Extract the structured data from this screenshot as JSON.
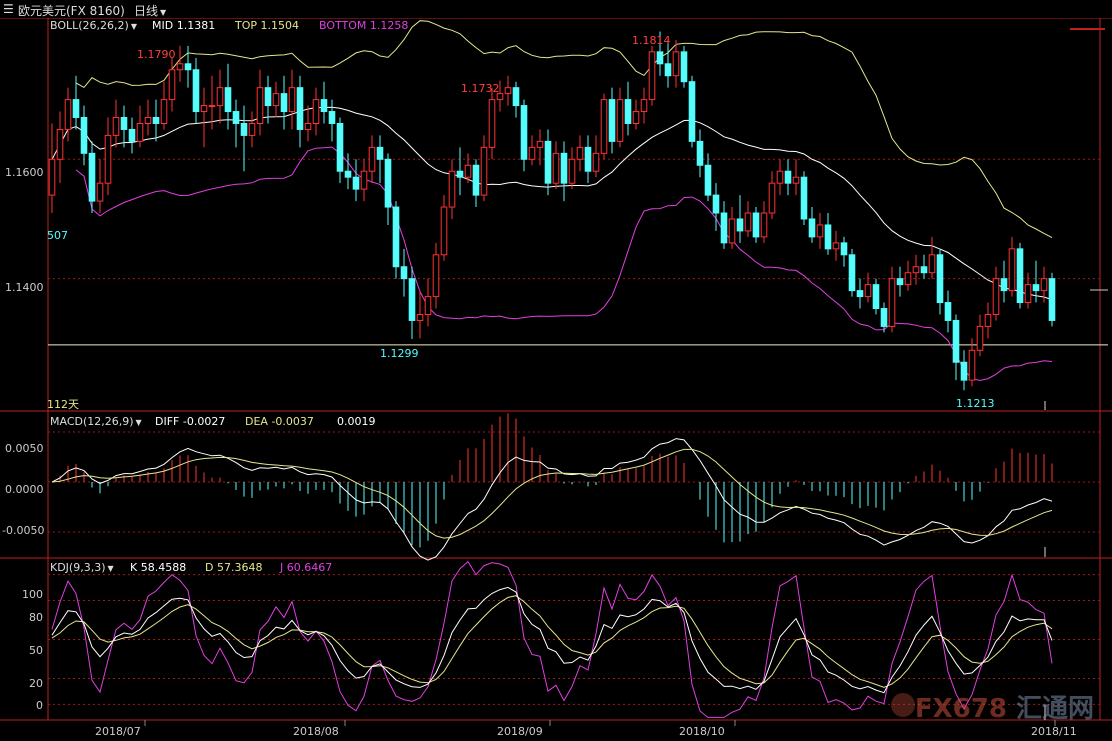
{
  "header": {
    "symbol_label": "欧元美元(FX 8160)",
    "period_label": "日线",
    "dropdown_icon": "chevron-down-icon"
  },
  "boll": {
    "label": "BOLL(26,26,2)",
    "mid_label": "MID 1.1381",
    "top_label": "TOP 1.1504",
    "bottom_label": "BOTTOM 1.1258",
    "colors": {
      "mid": "#ffffff",
      "top": "#e6e68c",
      "bottom": "#e040e0"
    }
  },
  "price_axis": {
    "ticks": [
      "1.1600",
      "1.1400"
    ],
    "left_value": "507"
  },
  "annotations": {
    "a1": "1.1790",
    "a2": "1.1732",
    "a3": "1.1814",
    "a4": "1.1299",
    "a5": "1.1213",
    "days": "112天"
  },
  "macd": {
    "label": "MACD(12,26,9)",
    "diff_label": "DIFF -0.0027",
    "dea_label": "DEA -0.0037",
    "macd_value": "0.0019",
    "ticks": [
      "0.0050",
      "0.0000",
      "-0.0050"
    ]
  },
  "kdj": {
    "label": "KDJ(9,3,3)",
    "k_label": "K 58.4588",
    "d_label": "D 57.3648",
    "j_label": "J 60.6467",
    "ticks": [
      "100",
      "80",
      "50",
      "20",
      "0"
    ]
  },
  "time_axis": [
    "2018/07",
    "2018/08",
    "2018/09",
    "2018/10",
    "2018/11"
  ],
  "watermark": {
    "text1": "FX678",
    "text2": "汇通网"
  },
  "chart_data": {
    "type": "candlestick",
    "price_range": [
      1.118,
      1.183
    ],
    "candles": [
      [
        1.154,
        1.16,
        1.166,
        1.151
      ],
      [
        1.16,
        1.165,
        1.168,
        1.156
      ],
      [
        1.165,
        1.17,
        1.172,
        1.163
      ],
      [
        1.17,
        1.167,
        1.174,
        1.165
      ],
      [
        1.167,
        1.161,
        1.169,
        1.159
      ],
      [
        1.161,
        1.153,
        1.163,
        1.151
      ],
      [
        1.153,
        1.156,
        1.16,
        1.151
      ],
      [
        1.156,
        1.164,
        1.167,
        1.154
      ],
      [
        1.164,
        1.167,
        1.17,
        1.162
      ],
      [
        1.167,
        1.165,
        1.169,
        1.162
      ],
      [
        1.165,
        1.163,
        1.167,
        1.161
      ],
      [
        1.163,
        1.166,
        1.169,
        1.162
      ],
      [
        1.166,
        1.167,
        1.17,
        1.164
      ],
      [
        1.167,
        1.166,
        1.17,
        1.163
      ],
      [
        1.166,
        1.17,
        1.173,
        1.165
      ],
      [
        1.17,
        1.175,
        1.177,
        1.168
      ],
      [
        1.175,
        1.176,
        1.179,
        1.173
      ],
      [
        1.176,
        1.175,
        1.179,
        1.172
      ],
      [
        1.175,
        1.168,
        1.177,
        1.166
      ],
      [
        1.168,
        1.169,
        1.172,
        1.162
      ],
      [
        1.169,
        1.169,
        1.174,
        1.165
      ],
      [
        1.169,
        1.172,
        1.175,
        1.166
      ],
      [
        1.172,
        1.168,
        1.176,
        1.165
      ],
      [
        1.168,
        1.166,
        1.17,
        1.162
      ],
      [
        1.166,
        1.164,
        1.169,
        1.158
      ],
      [
        1.164,
        1.166,
        1.168,
        1.162
      ],
      [
        1.166,
        1.172,
        1.175,
        1.164
      ],
      [
        1.172,
        1.169,
        1.174,
        1.166
      ],
      [
        1.169,
        1.171,
        1.173,
        1.167
      ],
      [
        1.171,
        1.168,
        1.174,
        1.165
      ],
      [
        1.168,
        1.172,
        1.175,
        1.165
      ],
      [
        1.172,
        1.165,
        1.174,
        1.162
      ],
      [
        1.165,
        1.166,
        1.169,
        1.163
      ],
      [
        1.166,
        1.17,
        1.172,
        1.164
      ],
      [
        1.17,
        1.168,
        1.173,
        1.166
      ],
      [
        1.168,
        1.166,
        1.17,
        1.163
      ],
      [
        1.166,
        1.158,
        1.167,
        1.156
      ],
      [
        1.158,
        1.157,
        1.161,
        1.155
      ],
      [
        1.157,
        1.155,
        1.16,
        1.153
      ],
      [
        1.155,
        1.158,
        1.16,
        1.153
      ],
      [
        1.158,
        1.162,
        1.164,
        1.156
      ],
      [
        1.162,
        1.16,
        1.164,
        1.156
      ],
      [
        1.16,
        1.152,
        1.161,
        1.149
      ],
      [
        1.152,
        1.142,
        1.153,
        1.14
      ],
      [
        1.142,
        1.14,
        1.145,
        1.137
      ],
      [
        1.14,
        1.133,
        1.142,
        1.1299
      ],
      [
        1.133,
        1.134,
        1.138,
        1.13
      ],
      [
        1.134,
        1.137,
        1.14,
        1.132
      ],
      [
        1.137,
        1.144,
        1.146,
        1.135
      ],
      [
        1.144,
        1.152,
        1.154,
        1.143
      ],
      [
        1.152,
        1.158,
        1.16,
        1.15
      ],
      [
        1.158,
        1.157,
        1.162,
        1.154
      ],
      [
        1.157,
        1.159,
        1.161,
        1.156
      ],
      [
        1.159,
        1.154,
        1.16,
        1.152
      ],
      [
        1.154,
        1.162,
        1.164,
        1.153
      ],
      [
        1.162,
        1.17,
        1.172,
        1.16
      ],
      [
        1.17,
        1.171,
        1.1732,
        1.168
      ],
      [
        1.171,
        1.172,
        1.174,
        1.169
      ],
      [
        1.172,
        1.169,
        1.173,
        1.167
      ],
      [
        1.169,
        1.16,
        1.17,
        1.158
      ],
      [
        1.16,
        1.162,
        1.164,
        1.159
      ],
      [
        1.162,
        1.163,
        1.165,
        1.159
      ],
      [
        1.163,
        1.156,
        1.165,
        1.154
      ],
      [
        1.156,
        1.161,
        1.163,
        1.155
      ],
      [
        1.161,
        1.156,
        1.163,
        1.153
      ],
      [
        1.156,
        1.16,
        1.162,
        1.155
      ],
      [
        1.16,
        1.162,
        1.164,
        1.158
      ],
      [
        1.162,
        1.158,
        1.164,
        1.156
      ],
      [
        1.158,
        1.161,
        1.164,
        1.157
      ],
      [
        1.161,
        1.17,
        1.171,
        1.16
      ],
      [
        1.17,
        1.163,
        1.172,
        1.161
      ],
      [
        1.163,
        1.17,
        1.172,
        1.162
      ],
      [
        1.17,
        1.166,
        1.173,
        1.164
      ],
      [
        1.166,
        1.168,
        1.17,
        1.165
      ],
      [
        1.168,
        1.17,
        1.172,
        1.166
      ],
      [
        1.17,
        1.178,
        1.179,
        1.169
      ],
      [
        1.178,
        1.176,
        1.1814,
        1.174
      ],
      [
        1.176,
        1.174,
        1.18,
        1.172
      ],
      [
        1.174,
        1.178,
        1.18,
        1.172
      ],
      [
        1.178,
        1.173,
        1.179,
        1.172
      ],
      [
        1.173,
        1.163,
        1.174,
        1.162
      ],
      [
        1.163,
        1.159,
        1.165,
        1.157
      ],
      [
        1.159,
        1.154,
        1.161,
        1.153
      ],
      [
        1.154,
        1.151,
        1.156,
        1.148
      ],
      [
        1.151,
        1.146,
        1.153,
        1.145
      ],
      [
        1.146,
        1.15,
        1.152,
        1.145
      ],
      [
        1.15,
        1.148,
        1.154,
        1.146
      ],
      [
        1.148,
        1.151,
        1.153,
        1.147
      ],
      [
        1.151,
        1.147,
        1.152,
        1.146
      ],
      [
        1.147,
        1.151,
        1.153,
        1.146
      ],
      [
        1.151,
        1.156,
        1.158,
        1.15
      ],
      [
        1.156,
        1.158,
        1.16,
        1.154
      ],
      [
        1.158,
        1.156,
        1.16,
        1.154
      ],
      [
        1.156,
        1.157,
        1.16,
        1.154
      ],
      [
        1.157,
        1.15,
        1.158,
        1.149
      ],
      [
        1.15,
        1.147,
        1.152,
        1.146
      ],
      [
        1.147,
        1.149,
        1.151,
        1.145
      ],
      [
        1.149,
        1.145,
        1.151,
        1.144
      ],
      [
        1.145,
        1.146,
        1.148,
        1.143
      ],
      [
        1.146,
        1.144,
        1.147,
        1.142
      ],
      [
        1.144,
        1.138,
        1.145,
        1.137
      ],
      [
        1.138,
        1.137,
        1.14,
        1.135
      ],
      [
        1.137,
        1.139,
        1.141,
        1.136
      ],
      [
        1.139,
        1.135,
        1.14,
        1.134
      ],
      [
        1.135,
        1.132,
        1.136,
        1.131
      ],
      [
        1.132,
        1.14,
        1.142,
        1.131
      ],
      [
        1.14,
        1.139,
        1.142,
        1.137
      ],
      [
        1.139,
        1.141,
        1.143,
        1.138
      ],
      [
        1.141,
        1.142,
        1.144,
        1.139
      ],
      [
        1.142,
        1.141,
        1.144,
        1.14
      ],
      [
        1.141,
        1.144,
        1.147,
        1.14
      ],
      [
        1.144,
        1.136,
        1.145,
        1.134
      ],
      [
        1.136,
        1.133,
        1.138,
        1.131
      ],
      [
        1.133,
        1.126,
        1.134,
        1.123
      ],
      [
        1.126,
        1.123,
        1.128,
        1.1213
      ],
      [
        1.123,
        1.128,
        1.13,
        1.122
      ],
      [
        1.128,
        1.132,
        1.134,
        1.127
      ],
      [
        1.132,
        1.134,
        1.136,
        1.13
      ],
      [
        1.134,
        1.14,
        1.142,
        1.133
      ],
      [
        1.14,
        1.138,
        1.143,
        1.136
      ],
      [
        1.138,
        1.145,
        1.147,
        1.137
      ],
      [
        1.145,
        1.136,
        1.146,
        1.135
      ],
      [
        1.136,
        1.139,
        1.141,
        1.135
      ],
      [
        1.139,
        1.138,
        1.143,
        1.136
      ],
      [
        1.138,
        1.14,
        1.142,
        1.136
      ],
      [
        1.14,
        1.133,
        1.141,
        1.132
      ]
    ],
    "macd_range": [
      -0.0075,
      0.007
    ],
    "kdj_range": [
      -12,
      112
    ],
    "up_color": "#ff3232",
    "down_color": "#54fcfc"
  }
}
